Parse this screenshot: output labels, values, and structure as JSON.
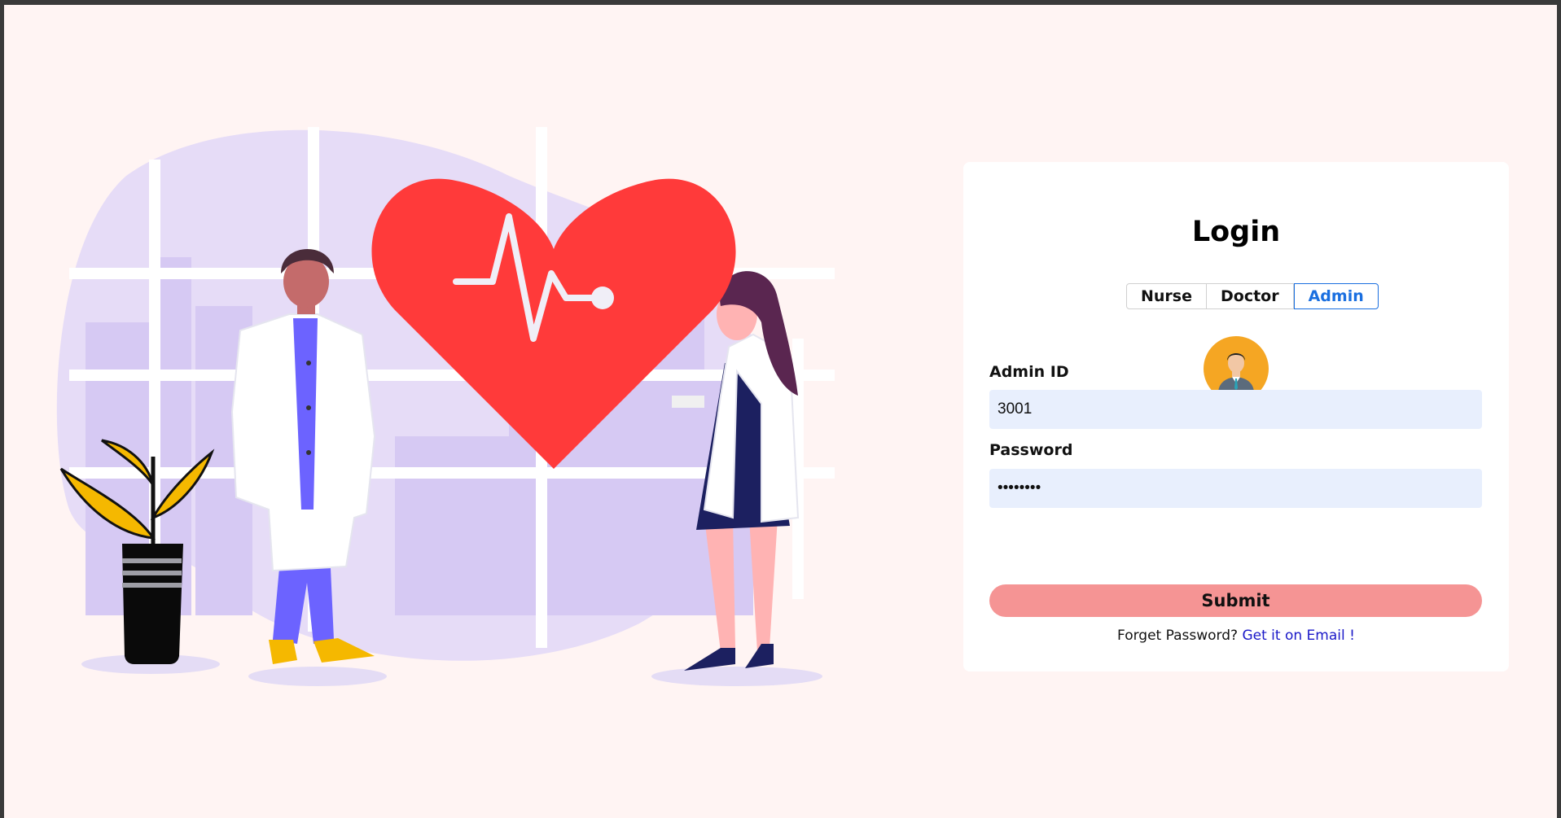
{
  "login": {
    "title": "Login",
    "roles": [
      "Nurse",
      "Doctor",
      "Admin"
    ],
    "active_role": "Admin",
    "id_label": "Admin ID",
    "id_value": "3001",
    "password_label": "Password",
    "password_value": "12345678",
    "submit_label": "Submit",
    "forgot_text": "Forget Password?",
    "forgot_link": "Get it on Email !"
  },
  "colors": {
    "page_bg": "#fff4f3",
    "heart": "#ff3a3a",
    "submit": "#f59494",
    "active_tab": "#1a6fe0",
    "input_bg": "#e8effd",
    "avatar_bg": "#f5a623"
  }
}
